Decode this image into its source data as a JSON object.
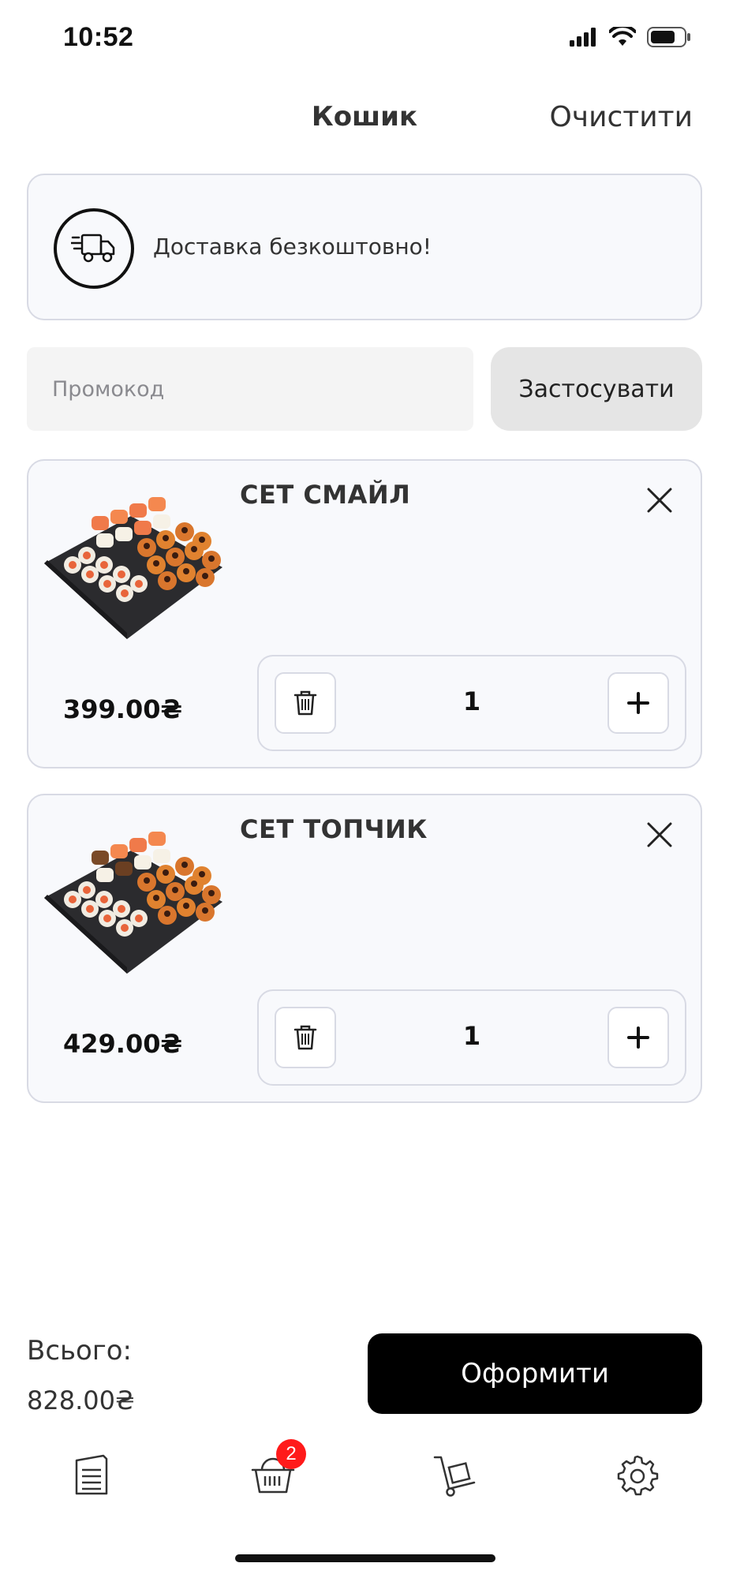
{
  "status_bar": {
    "time": "10:52"
  },
  "header": {
    "title": "Кошик",
    "clear_label": "Очистити"
  },
  "delivery": {
    "icon": "delivery-truck-icon",
    "text": "Доставка безкоштовно!"
  },
  "promo": {
    "placeholder": "Промокод",
    "value": "",
    "apply_label": "Застосувати"
  },
  "cart_items": [
    {
      "name": "СЕТ СМАЙЛ",
      "price": "399.00₴",
      "quantity": "1"
    },
    {
      "name": "СЕТ ТОПЧИК",
      "price": "429.00₴",
      "quantity": "1"
    }
  ],
  "summary": {
    "total_label": "Всього:",
    "total_value": "828.00₴",
    "checkout_label": "Оформити"
  },
  "tab_bar": {
    "tabs": [
      {
        "icon": "menu-list-icon"
      },
      {
        "icon": "basket-icon",
        "badge": "2"
      },
      {
        "icon": "hand-truck-icon"
      },
      {
        "icon": "settings-gear-icon"
      }
    ]
  },
  "colors": {
    "accent": "#000000",
    "badge": "#ff1a1a",
    "card_bg": "#f8f9fc",
    "card_border": "#d8dae4"
  }
}
